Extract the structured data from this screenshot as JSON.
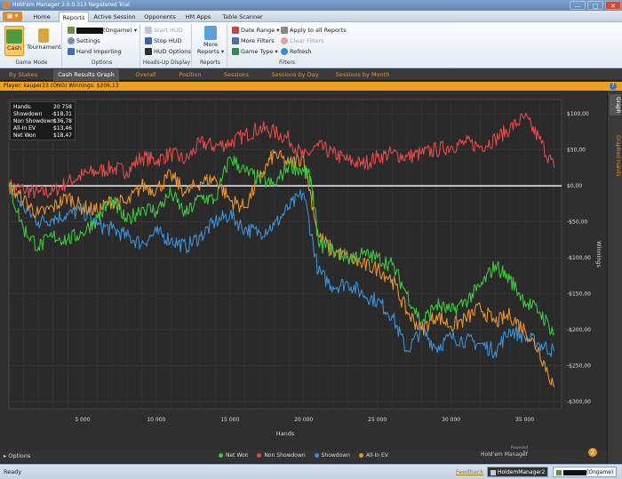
{
  "window": {
    "title": "Hold'em Manager 2.0.0.313 Registered Trial",
    "minimize": "—",
    "maximize": "□",
    "close": "✕"
  },
  "menu": {
    "quick_access": "▣ ▾",
    "items": [
      "Home",
      "Reports",
      "Active Session",
      "Opponents",
      "HM Apps",
      "Table Scanner"
    ],
    "active": "Reports"
  },
  "ribbon": {
    "game_mode": {
      "title": "Game Mode",
      "cash": "Cash",
      "tournament": "Tournament"
    },
    "options": {
      "title": "Options",
      "player_select": "(Ongame) ▾",
      "settings": "Settings",
      "hand_importing": "Hand Importing"
    },
    "hud": {
      "title": "Heads-Up Display",
      "start_hud": "Start HUD",
      "stop_hud": "Stop HUD",
      "hud_options": "HUD Options"
    },
    "reports": {
      "title": "Reports",
      "more_reports": "More Reports ▾"
    },
    "filters": {
      "title": "Filters",
      "date_range": "Date Range ▾",
      "more_filters": "More Filters",
      "game_type": "Game Type ▾",
      "apply_all": "Apply to all Reports",
      "clear_filters": "Clear Filters",
      "refresh": "Refresh"
    }
  },
  "view_tabs": [
    "By Stakes",
    "Cash Results Graph",
    "Overall",
    "Position",
    "Sessions",
    "Sessions by Day",
    "Sessions by Month"
  ],
  "active_view_tab": "Cash Results Graph",
  "player_bar": {
    "text": "Player: kauper23 (ONG) Winnings: $206,13",
    "help": "?"
  },
  "side_tabs": {
    "graph": "Graph",
    "graphed_hands": "Graphed Hands"
  },
  "stats": [
    {
      "label": "Hands:",
      "value": "20 758"
    },
    {
      "label": "Showdown",
      "value": "-$18,31"
    },
    {
      "label": "Non Showdown",
      "value": "$36,78"
    },
    {
      "label": "All-In EV",
      "value": "$13,46"
    },
    {
      "label": "Net Won",
      "value": "$18,47"
    }
  ],
  "options_button": "▸ Options",
  "brand": {
    "powered": "Powered by",
    "name": "Hold'em Manager",
    "logo": "2"
  },
  "status": {
    "ready": "Ready",
    "feedback": "Feedback",
    "app_chip": "HoldemManager2",
    "player_chip": "(Ongame)"
  },
  "chart_data": {
    "type": "line",
    "xlabel": "Hands",
    "ylabel": "Winnings",
    "xlim": [
      0,
      37500
    ],
    "ylim": [
      -310,
      120
    ],
    "x_ticks": [
      "5 000",
      "10 000",
      "15 000",
      "20 000",
      "25 000",
      "30 000",
      "35 000"
    ],
    "x_tick_values": [
      5000,
      10000,
      15000,
      20000,
      25000,
      30000,
      35000
    ],
    "y_ticks": [
      "$100,00",
      "$50,00",
      "$0,00",
      "-$50,00",
      "-$100,00",
      "-$150,00",
      "-$200,00",
      "-$250,00",
      "-$300,00"
    ],
    "y_tick_values": [
      100,
      50,
      0,
      -50,
      -100,
      -150,
      -200,
      -250,
      -300
    ],
    "grid": true,
    "legend_position": "bottom-center",
    "series": [
      {
        "name": "Net Won",
        "color": "#3ec43e",
        "x": [
          0,
          1000,
          2000,
          3000,
          4000,
          5000,
          6000,
          7000,
          8000,
          9000,
          10000,
          11000,
          12000,
          13000,
          14000,
          15000,
          16000,
          17000,
          18000,
          19000,
          20000,
          20500,
          21000,
          22000,
          23000,
          24000,
          25000,
          26000,
          27000,
          28000,
          29000,
          30000,
          31000,
          32000,
          33000,
          34000,
          35000,
          36000,
          37000
        ],
        "y": [
          0,
          -60,
          -85,
          -70,
          -75,
          -65,
          -45,
          -20,
          -50,
          -30,
          -35,
          -10,
          -40,
          -15,
          -20,
          40,
          20,
          10,
          0,
          30,
          20,
          10,
          -80,
          -90,
          -100,
          -95,
          -100,
          -110,
          -150,
          -190,
          -165,
          -175,
          -160,
          -140,
          -110,
          -130,
          -160,
          -175,
          -205
        ]
      },
      {
        "name": "Non Showdown",
        "color": "#e04a4a",
        "x": [
          0,
          1000,
          2000,
          3000,
          4000,
          5000,
          6000,
          7000,
          8000,
          9000,
          10000,
          11000,
          12000,
          13000,
          14000,
          15000,
          16000,
          17000,
          18000,
          19000,
          20000,
          21000,
          22000,
          23000,
          24000,
          25000,
          26000,
          27000,
          28000,
          29000,
          30000,
          31000,
          32000,
          33000,
          34000,
          35000,
          36000,
          37000
        ],
        "y": [
          0,
          -5,
          -10,
          -8,
          5,
          15,
          20,
          25,
          20,
          40,
          35,
          45,
          35,
          60,
          55,
          60,
          70,
          80,
          75,
          65,
          40,
          55,
          45,
          35,
          30,
          40,
          45,
          40,
          45,
          50,
          55,
          60,
          55,
          65,
          80,
          95,
          65,
          25
        ]
      },
      {
        "name": "Showdown",
        "color": "#3a8fd4",
        "x": [
          0,
          1000,
          2000,
          3000,
          4000,
          5000,
          6000,
          7000,
          8000,
          9000,
          10000,
          11000,
          12000,
          13000,
          14000,
          15000,
          16000,
          17000,
          18000,
          19000,
          20000,
          21000,
          22000,
          23000,
          24000,
          25000,
          26000,
          27000,
          28000,
          29000,
          30000,
          31000,
          32000,
          33000,
          34000,
          35000,
          36000,
          37000
        ],
        "y": [
          0,
          -30,
          -50,
          -45,
          -40,
          -35,
          -55,
          -60,
          -70,
          -80,
          -65,
          -75,
          -85,
          -70,
          -50,
          -40,
          -60,
          -65,
          -55,
          -30,
          -10,
          -120,
          -140,
          -135,
          -150,
          -160,
          -180,
          -230,
          -200,
          -225,
          -210,
          -215,
          -220,
          -230,
          -200,
          -210,
          -220,
          -230
        ]
      },
      {
        "name": "All-In EV",
        "color": "#e8912f",
        "x": [
          0,
          1000,
          2000,
          3000,
          4000,
          5000,
          6000,
          7000,
          8000,
          9000,
          10000,
          11000,
          12000,
          13000,
          14000,
          15000,
          16000,
          17000,
          18000,
          19000,
          20000,
          21000,
          22000,
          23000,
          24000,
          25000,
          26000,
          27000,
          28000,
          29000,
          30000,
          31000,
          32000,
          33000,
          34000,
          35000,
          36000,
          37000
        ],
        "y": [
          0,
          -20,
          -40,
          -30,
          -15,
          -30,
          -35,
          -20,
          -25,
          0,
          -5,
          15,
          -10,
          5,
          10,
          -20,
          -30,
          10,
          45,
          30,
          40,
          -70,
          -90,
          -100,
          -110,
          -115,
          -130,
          -175,
          -200,
          -180,
          -195,
          -185,
          -170,
          -190,
          -180,
          -200,
          -230,
          -280
        ]
      }
    ]
  }
}
